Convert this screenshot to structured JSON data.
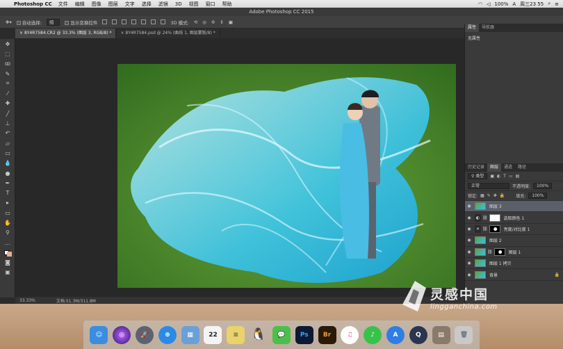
{
  "menubar": {
    "app_name": "Photoshop CC",
    "items": [
      "文件",
      "编辑",
      "图像",
      "图层",
      "文字",
      "选择",
      "滤镜",
      "3D",
      "视图",
      "窗口",
      "帮助"
    ],
    "battery": "100%",
    "clock": "周三23 55"
  },
  "window": {
    "title": "Adobe Photoshop CC 2015"
  },
  "options": {
    "auto_select_label": "自动选择:",
    "auto_select_value": "组",
    "show_transform_label": "显示变换控件",
    "mode3d_label": "3D 模式:"
  },
  "tabs": [
    {
      "label": "8Y4R7584.CR2 @ 33.3% (图层 3, RGB/8) *"
    },
    {
      "label": "8Y4R7584.psd @ 24% (曲线 1, 图层蒙版/8) *"
    }
  ],
  "status": {
    "zoom": "33.33%",
    "doc": "文档:51.3M/311.8M"
  },
  "properties": {
    "tabs": [
      "属性",
      "导航器"
    ],
    "body": "无属性"
  },
  "layers_panel": {
    "tabs": [
      "历史记录",
      "图层",
      "通道",
      "路径"
    ],
    "filter": "类型",
    "blend_mode": "正常",
    "opacity_label": "不透明度:",
    "opacity": "100%",
    "lock_label": "锁定:",
    "fill_label": "填充:",
    "fill": "100%",
    "layers": [
      {
        "name": "图层 3",
        "kind": "photo",
        "selected": true
      },
      {
        "name": "选取颜色 1",
        "kind": "adj-white"
      },
      {
        "name": "亮度/对比度 1",
        "kind": "adj-black"
      },
      {
        "name": "图层 2",
        "kind": "photo"
      },
      {
        "name": "图层 1",
        "kind": "photo-mask"
      },
      {
        "name": "图层 1 拷贝",
        "kind": "photo"
      },
      {
        "name": "背景",
        "kind": "photo"
      }
    ]
  },
  "watermark": {
    "title": "灵感中国",
    "url": "lingganchina.com"
  },
  "dock": [
    {
      "name": "finder",
      "label": "",
      "color": "#3b8de0"
    },
    {
      "name": "siri",
      "label": "",
      "color": "#7a3cc8"
    },
    {
      "name": "launchpad",
      "label": "",
      "color": "#5c6270"
    },
    {
      "name": "safari",
      "label": "",
      "color": "#2b8ae6"
    },
    {
      "name": "preview",
      "label": "",
      "color": "#6aa0d8"
    },
    {
      "name": "calendar",
      "label": "22",
      "color": "#f4f4f4"
    },
    {
      "name": "notes",
      "label": "",
      "color": "#e9d36a"
    },
    {
      "name": "qq",
      "label": "",
      "color": "#1a1a1a"
    },
    {
      "name": "wechat",
      "label": "",
      "color": "#4ac04a"
    },
    {
      "name": "photoshop",
      "label": "Ps",
      "color": "#0e1a33"
    },
    {
      "name": "bridge",
      "label": "Br",
      "color": "#2a1a08"
    },
    {
      "name": "itunes",
      "label": "",
      "color": "#e84c8a"
    },
    {
      "name": "music",
      "label": "",
      "color": "#38c24a"
    },
    {
      "name": "appstore",
      "label": "",
      "color": "#2f7ee6"
    },
    {
      "name": "quicktime",
      "label": "",
      "color": "#2a3550"
    },
    {
      "name": "photos-stack",
      "label": "",
      "color": "#8a7a6a"
    },
    {
      "name": "trash",
      "label": "",
      "color": "#c9c9c9"
    }
  ]
}
